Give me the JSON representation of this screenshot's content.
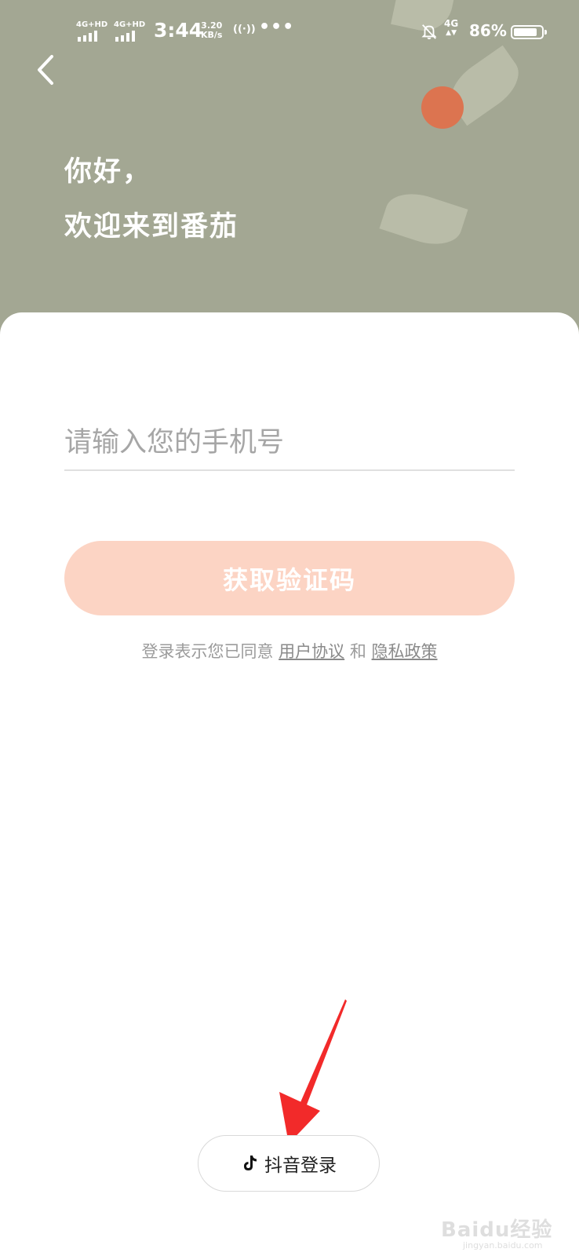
{
  "status_bar": {
    "sim1_tag": "4G+HD",
    "sim2_tag": "4G+HD",
    "time": "3:44",
    "speed_value": "3.20",
    "speed_unit": "KB/s",
    "more": "•••",
    "net_tag": "4G",
    "battery_percent": "86%",
    "battery_level": 86
  },
  "header": {
    "back_icon": "chevron-left-icon",
    "greeting_line1": "你好，",
    "greeting_line2": "欢迎来到番茄",
    "accent_color": "#dc7450",
    "background_color": "#a3a793"
  },
  "login": {
    "phone_placeholder": "请输入您的手机号",
    "phone_value": "",
    "get_code_label": "获取验证码",
    "button_color": "#fcd4c4",
    "agreement_prefix": "登录表示您已同意",
    "user_agreement": "用户协议",
    "and": "和",
    "privacy_policy": "隐私政策"
  },
  "alt_login": {
    "douyin_label": "抖音登录",
    "douyin_icon": "douyin-icon"
  },
  "watermark": {
    "text": "Baidu经验",
    "sub": "jingyan.baidu.com"
  }
}
